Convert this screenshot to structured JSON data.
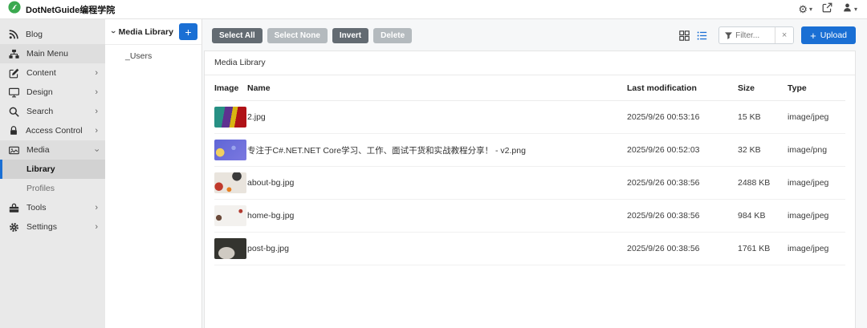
{
  "topbar": {
    "brand": "DotNetGuide编程学院"
  },
  "icons": {
    "plus": "+",
    "clear": "×",
    "chevron_right": "›",
    "caret": "▾",
    "gear": "⚙"
  },
  "sidebar": {
    "items": [
      {
        "label": "Blog"
      },
      {
        "label": "Main Menu"
      },
      {
        "label": "Content"
      },
      {
        "label": "Design"
      },
      {
        "label": "Search"
      },
      {
        "label": "Access Control"
      },
      {
        "label": "Media"
      },
      {
        "label": "Library"
      },
      {
        "label": "Profiles"
      },
      {
        "label": "Tools"
      },
      {
        "label": "Settings"
      }
    ]
  },
  "tree": {
    "root_label": "Media Library",
    "folders": [
      "_Users"
    ]
  },
  "toolbar": {
    "select_all": "Select All",
    "select_none": "Select None",
    "invert": "Invert",
    "delete": "Delete",
    "filter_placeholder": "Filter...",
    "upload": "Upload"
  },
  "panel": {
    "title": "Media Library"
  },
  "table": {
    "headers": [
      "Image",
      "Name",
      "Last modification",
      "Size",
      "Type"
    ],
    "rows": [
      {
        "name": "2.jpg",
        "modified": "2025/9/26 00:53:16",
        "size": "15 KB",
        "type": "image/jpeg"
      },
      {
        "name": "专注于C#.NET.NET Core学习、工作、面试干货和实战教程分享！ - v2.png",
        "modified": "2025/9/26 00:52:03",
        "size": "32 KB",
        "type": "image/png"
      },
      {
        "name": "about-bg.jpg",
        "modified": "2025/9/26 00:38:56",
        "size": "2488 KB",
        "type": "image/jpeg"
      },
      {
        "name": "home-bg.jpg",
        "modified": "2025/9/26 00:38:56",
        "size": "984 KB",
        "type": "image/jpeg"
      },
      {
        "name": "post-bg.jpg",
        "modified": "2025/9/26 00:38:56",
        "size": "1761 KB",
        "type": "image/jpeg"
      }
    ]
  },
  "colors": {
    "accent": "#1a6fd4",
    "button_dark": "#636b72",
    "button_muted": "#b4babe",
    "sidebar_bg": "#e9e9e9",
    "active_item_bg": "#d2d2d2"
  }
}
